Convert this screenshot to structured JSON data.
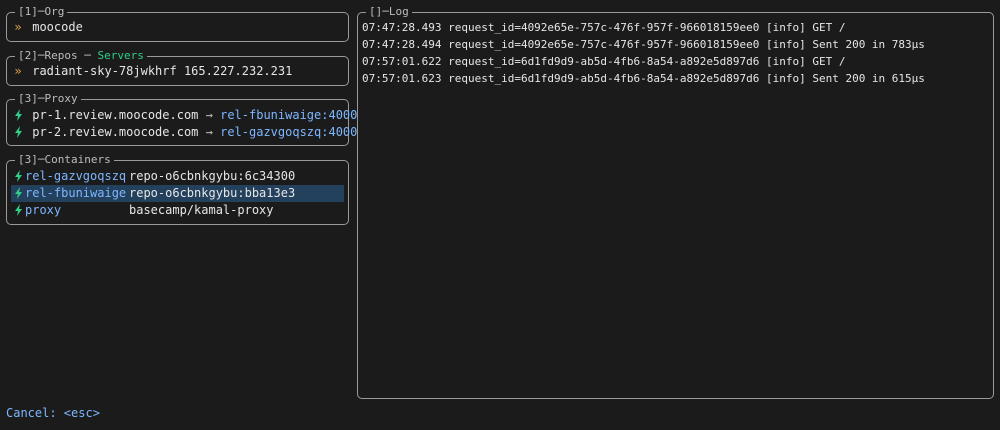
{
  "org": {
    "title": "[1]",
    "title_name": "Org",
    "value": "moocode"
  },
  "repos": {
    "title": "[2]",
    "title_name": "Repos",
    "tab_servers": "Servers",
    "value": "radiant-sky-78jwkhrf 165.227.232.231"
  },
  "proxy": {
    "title": "[3]",
    "title_name": "Proxy",
    "items": [
      {
        "host": "pr-1.review.moocode.com",
        "arrow": "→",
        "target": "rel-fbuniwaige:4000"
      },
      {
        "host": "pr-2.review.moocode.com",
        "arrow": "→",
        "target": "rel-gazvgoqszq:4000"
      }
    ]
  },
  "containers": {
    "title": "[3]",
    "title_name": "Containers",
    "items": [
      {
        "name": "rel-gazvgoqszq",
        "image": "repo-o6cbnkgybu:6c34300",
        "selected": false
      },
      {
        "name": "rel-fbuniwaige",
        "image": "repo-o6cbnkgybu:bba13e3",
        "selected": true
      },
      {
        "name": "proxy",
        "image": "basecamp/kamal-proxy",
        "selected": false
      }
    ]
  },
  "log": {
    "title": "[]",
    "title_name": "Log",
    "lines": [
      "07:47:28.493 request_id=4092e65e-757c-476f-957f-966018159ee0 [info] GET /",
      "07:47:28.494 request_id=4092e65e-757c-476f-957f-966018159ee0 [info] Sent 200 in 783µs",
      "07:57:01.622 request_id=6d1fd9d9-ab5d-4fb6-8a54-a892e5d897d6 [info] GET /",
      "07:57:01.623 request_id=6d1fd9d9-ab5d-4fb6-8a54-a892e5d897d6 [info] Sent 200 in 615µs"
    ]
  },
  "footer": {
    "cancel": "Cancel: <esc>"
  },
  "icons": {
    "chevron": "chevron-right-icon",
    "bolt": "lightning-bolt-icon"
  },
  "colors": {
    "background": "#1b1b1b",
    "border": "#9a9a9a",
    "accent_blue": "#7eb6ff",
    "accent_green": "#2fcf88",
    "chevron": "#d9a04c",
    "selection": "#23405c"
  }
}
